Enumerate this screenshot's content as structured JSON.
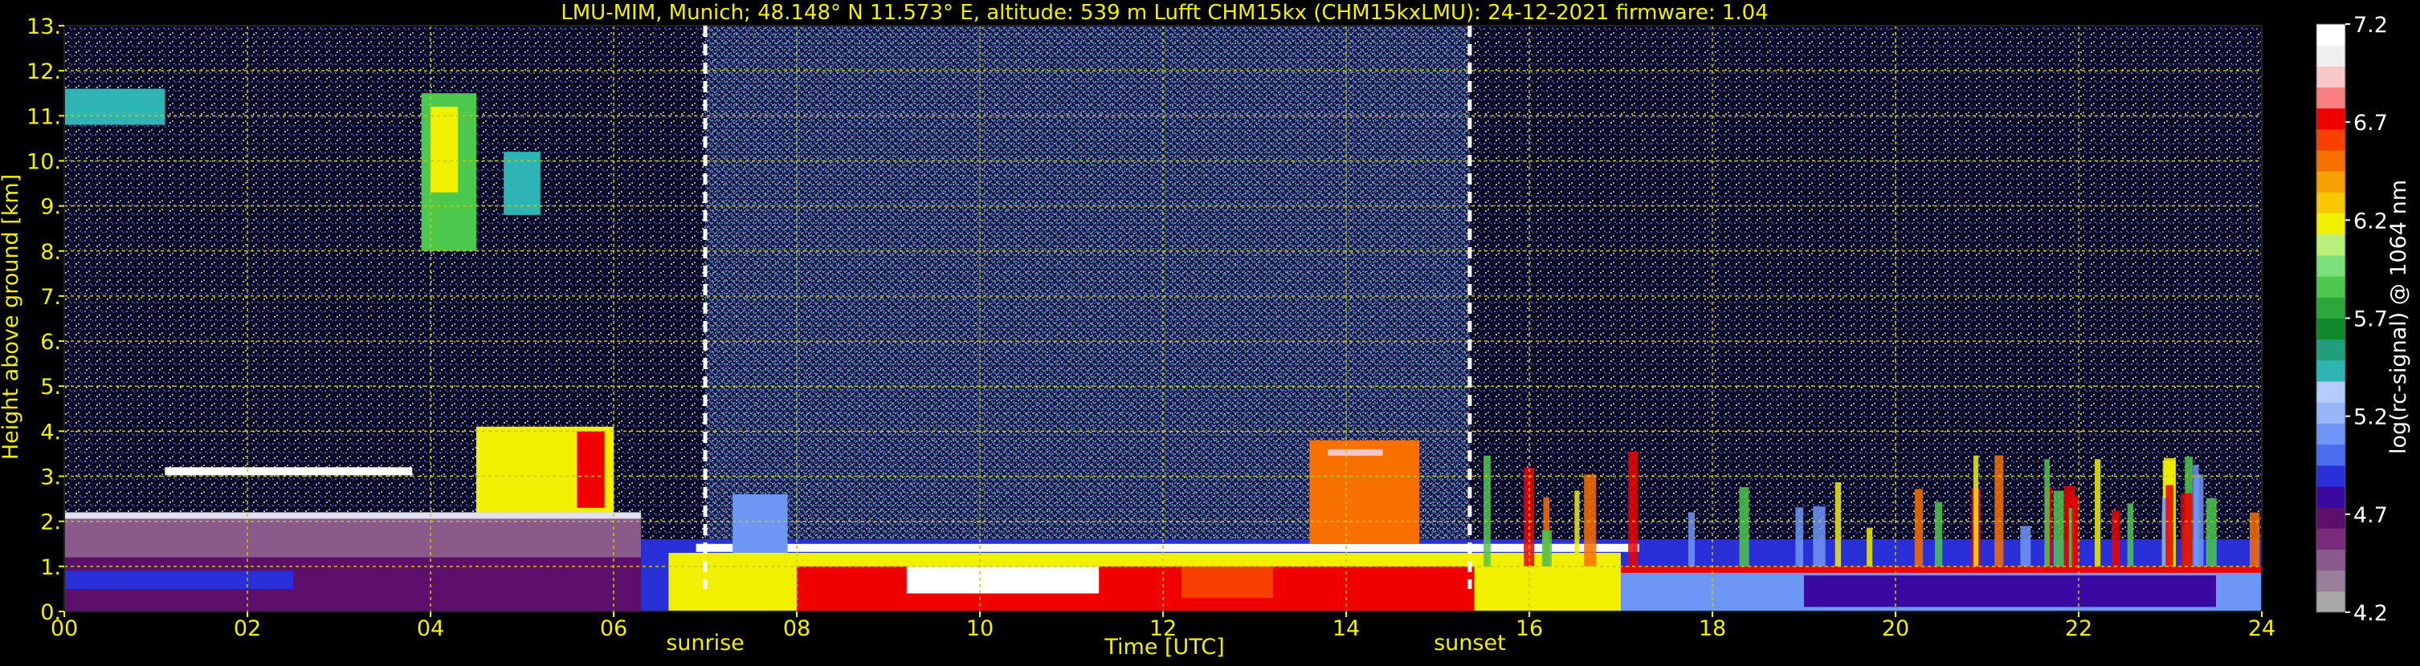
{
  "chart_data": {
    "type": "heatmap",
    "title": "LMU-MIM, Munich; 48.148° N 11.573° E, altitude: 539 m    Lufft CHM15kx (CHM15kxLMU): 24-12-2021    firmware: 1.04",
    "xlabel": "Time [UTC]",
    "ylabel": "Height above ground [km]",
    "colorbar_label": "log(rc-signal) @ 1064 nm",
    "x_ticks": [
      "00",
      "02",
      "04",
      "06",
      "08",
      "10",
      "12",
      "14",
      "16",
      "18",
      "20",
      "22",
      "24"
    ],
    "y_ticks": [
      "0.",
      "1.",
      "2.",
      "3.",
      "4.",
      "5.",
      "6.",
      "7.",
      "8.",
      "9.",
      "10.",
      "11.",
      "12.",
      "13."
    ],
    "colorbar_ticks": [
      "4.2",
      "4.7",
      "5.2",
      "5.7",
      "6.2",
      "6.7",
      "7.2"
    ],
    "xlim": [
      0,
      24
    ],
    "ylim": [
      0,
      13
    ],
    "clim": [
      4.2,
      7.2
    ],
    "grid": true,
    "colormap": [
      "#a8a8a8",
      "#9a7f9a",
      "#8a5a8a",
      "#7a2a7a",
      "#5c0f6b",
      "#3a0aa0",
      "#2a30d8",
      "#4a6ef0",
      "#6e96f5",
      "#96b6f8",
      "#b6ccfa",
      "#2fb4b4",
      "#1fa07a",
      "#0f8a2a",
      "#2aa83a",
      "#4cc84c",
      "#7ae07a",
      "#b8f07a",
      "#f0f000",
      "#f8c800",
      "#f8a000",
      "#f87000",
      "#f84000",
      "#f00000",
      "#f88080",
      "#f8c8c8",
      "#f0f0f0",
      "#ffffff"
    ],
    "annotations": [
      {
        "label": "sunrise",
        "x": 7.0
      },
      {
        "label": "sunset",
        "x": 15.35
      }
    ],
    "layers": [
      {
        "kind": "aerosol boundary layer",
        "x_range": [
          0,
          6.3
        ],
        "top_km": 2.1
      },
      {
        "kind": "boundary layer",
        "x_range": [
          6.3,
          24
        ],
        "top_km": 1.5
      },
      {
        "kind": "low cloud layer",
        "x_range": [
          6.9,
          15.5
        ],
        "base_km": 0.6,
        "top_km": 2.7
      },
      {
        "kind": "cirrus",
        "x_range": [
          3.9,
          5.2
        ],
        "base_km": 8.0,
        "top_km": 11.5
      },
      {
        "kind": "cirrus",
        "x_range": [
          0,
          1.1
        ],
        "base_km": 10.8,
        "top_km": 11.6
      },
      {
        "kind": "cloud tops",
        "x_range": [
          13.6,
          14.8
        ],
        "base_km": 2.5,
        "top_km": 3.8
      },
      {
        "kind": "mid-level cloud",
        "x_range": [
          1.1,
          3.8
        ],
        "base_km": 2.6,
        "top_km": 3.3
      }
    ],
    "colors": {
      "axis_text": "#f0f000",
      "title_text": "#f0f000",
      "grid": "#c8c800",
      "markers": "#ffffff",
      "colorbar_text": "#ffffff",
      "background": "#000000"
    }
  }
}
